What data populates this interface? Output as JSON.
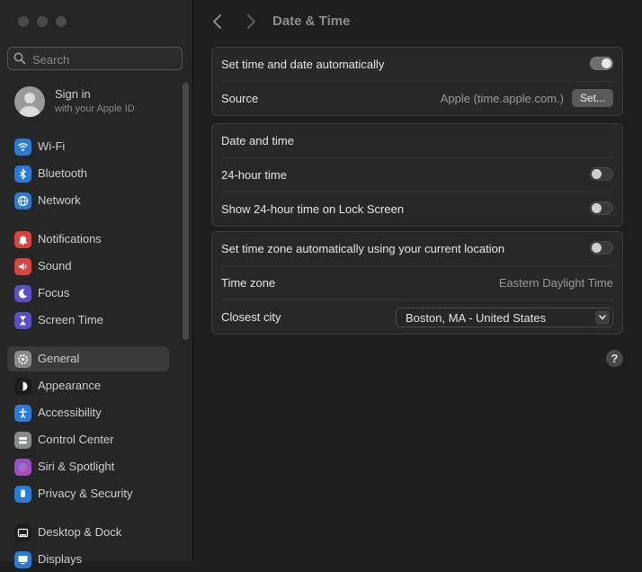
{
  "search": {
    "placeholder": "Search"
  },
  "account": {
    "title": "Sign in",
    "subtitle": "with your Apple ID"
  },
  "sidebar": {
    "groups": [
      [
        {
          "label": "Wi-Fi",
          "icon": "wifi-icon",
          "color": "#2a7bd6"
        },
        {
          "label": "Bluetooth",
          "icon": "bluetooth-icon",
          "color": "#2a7bd6"
        },
        {
          "label": "Network",
          "icon": "globe-icon",
          "color": "#2a7bd6"
        }
      ],
      [
        {
          "label": "Notifications",
          "icon": "bell-icon",
          "color": "#d9443f"
        },
        {
          "label": "Sound",
          "icon": "speaker-icon",
          "color": "#d9443f"
        },
        {
          "label": "Focus",
          "icon": "moon-icon",
          "color": "#5a51c9"
        },
        {
          "label": "Screen Time",
          "icon": "hourglass-icon",
          "color": "#5a51c9"
        }
      ],
      [
        {
          "label": "General",
          "icon": "gear-icon",
          "color": "#8a8a8a",
          "selected": true
        },
        {
          "label": "Appearance",
          "icon": "appearance-icon",
          "color": "#1c1c1c"
        },
        {
          "label": "Accessibility",
          "icon": "accessibility-icon",
          "color": "#2a7bd6"
        },
        {
          "label": "Control Center",
          "icon": "control-center-icon",
          "color": "#8a8a8a"
        },
        {
          "label": "Siri & Spotlight",
          "icon": "siri-icon",
          "color": "#9b4fc2"
        },
        {
          "label": "Privacy & Security",
          "icon": "hand-icon",
          "color": "#2a7bd6"
        }
      ],
      [
        {
          "label": "Desktop & Dock",
          "icon": "dock-icon",
          "color": "#1c1c1c"
        },
        {
          "label": "Displays",
          "icon": "display-icon",
          "color": "#2a7bd6"
        }
      ]
    ]
  },
  "header": {
    "title": "Date & Time"
  },
  "auto_section": {
    "set_auto_label": "Set time and date automatically",
    "set_auto_on": true,
    "source_label": "Source",
    "source_value": "Apple (time.apple.com.)",
    "set_button": "Set..."
  },
  "format_section": {
    "header": "Date and time",
    "hour24_label": "24-hour time",
    "hour24_on": false,
    "lock_label": "Show 24-hour time on Lock Screen",
    "lock_on": false
  },
  "timezone_section": {
    "auto_tz_label": "Set time zone automatically using your current location",
    "auto_tz_on": false,
    "tz_label": "Time zone",
    "tz_value": "Eastern Daylight Time",
    "city_label": "Closest city",
    "city_value": "Boston, MA - United States"
  },
  "help": {
    "label": "?"
  }
}
